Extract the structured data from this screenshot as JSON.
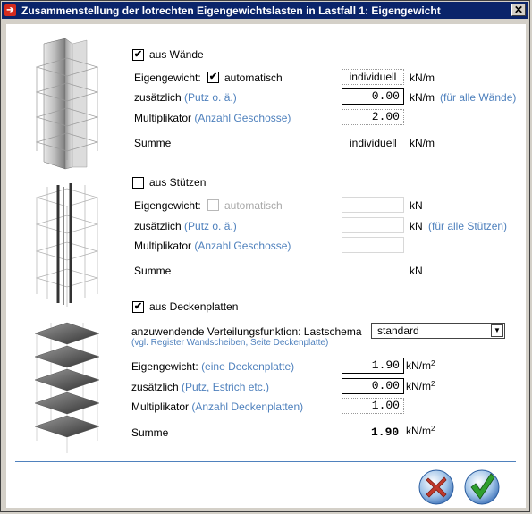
{
  "window": {
    "title": "Zusammenstellung der lotrechten Eigengewichtslasten in Lastfall 1: Eigengewicht"
  },
  "icons": {
    "title": "arrow-right-icon",
    "close": "close-icon"
  },
  "walls": {
    "checkbox_label": "aus Wände",
    "checked": true,
    "eigengewicht_label": "Eigengewicht:",
    "auto_checked": true,
    "auto_label": "automatisch",
    "eigengewicht_value": "individuell",
    "unit": "kN/m",
    "zusaetzlich_label": "zusätzlich",
    "zusaetzlich_hint": "(Putz o. ä.)",
    "zusaetzlich_value": "0.00",
    "zusaetzlich_note": "(für alle Wände)",
    "multiplikator_label": "Multiplikator",
    "multiplikator_hint": "(Anzahl Geschosse)",
    "multiplikator_value": "2.00",
    "summe_label": "Summe",
    "summe_value": "individuell",
    "summe_unit": "kN/m"
  },
  "columns": {
    "checkbox_label": "aus Stützen",
    "checked": false,
    "eigengewicht_label": "Eigengewicht:",
    "auto_label": "automatisch",
    "unit": "kN",
    "zusaetzlich_label": "zusätzlich",
    "zusaetzlich_hint": "(Putz o. ä.)",
    "zusaetzlich_note": "(für alle Stützen)",
    "multiplikator_label": "Multiplikator",
    "multiplikator_hint": "(Anzahl Geschosse)",
    "summe_label": "Summe",
    "summe_unit": "kN"
  },
  "slabs": {
    "checkbox_label": "aus Deckenplatten",
    "checked": true,
    "verteilung_label": "anzuwendende Verteilungsfunktion: Lastschema",
    "verteilung_value": "standard",
    "verteilung_hint": "(vgl. Register Wandscheiben, Seite Deckenplatte)",
    "eigengewicht_label": "Eigengewicht:",
    "eigengewicht_hint": "(eine Deckenplatte)",
    "eigengewicht_value": "1.90",
    "unit": "kN/m",
    "unit_sup": "2",
    "zusaetzlich_label": "zusätzlich",
    "zusaetzlich_hint": "(Putz, Estrich etc.)",
    "zusaetzlich_value": "0.00",
    "multiplikator_label": "Multiplikator",
    "multiplikator_hint": "(Anzahl Deckenplatten)",
    "multiplikator_value": "1.00",
    "summe_label": "Summe",
    "summe_value": "1.90"
  },
  "buttons": {
    "cancel": "cancel-x-icon",
    "ok": "ok-check-icon"
  },
  "colors": {
    "title_bg": "#0a246a",
    "accent": "#4f81bd",
    "cancel": "#c0392b",
    "ok": "#2e9e2e"
  }
}
